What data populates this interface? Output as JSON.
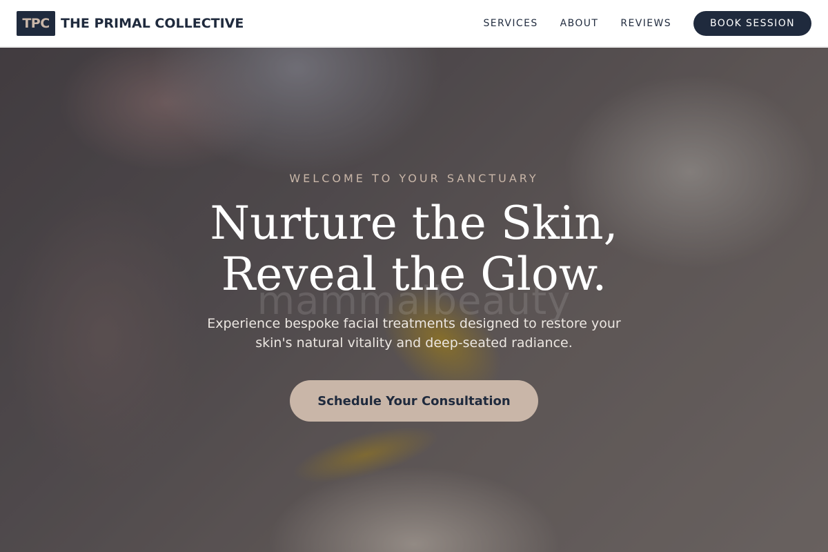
{
  "header": {
    "logo_text": "TPC",
    "brand_name": "THE PRIMAL COLLECTIVE",
    "nav": [
      {
        "label": "SERVICES"
      },
      {
        "label": "ABOUT"
      },
      {
        "label": "REVIEWS"
      }
    ],
    "book_label": "BOOK SESSION"
  },
  "hero": {
    "eyebrow": "WELCOME TO YOUR SANCTUARY",
    "headline_line1": "Nurture the Skin,",
    "headline_line2": "Reveal the Glow.",
    "watermark": "mammalbeauty",
    "subtext_line1": "Experience bespoke facial treatments designed to restore your",
    "subtext_line2": "skin's natural vitality and deep-seated radiance.",
    "cta_label": "Schedule Your Consultation"
  },
  "colors": {
    "navy": "#1f2a3d",
    "accent_beige": "#c9b6a8",
    "white": "#ffffff"
  }
}
